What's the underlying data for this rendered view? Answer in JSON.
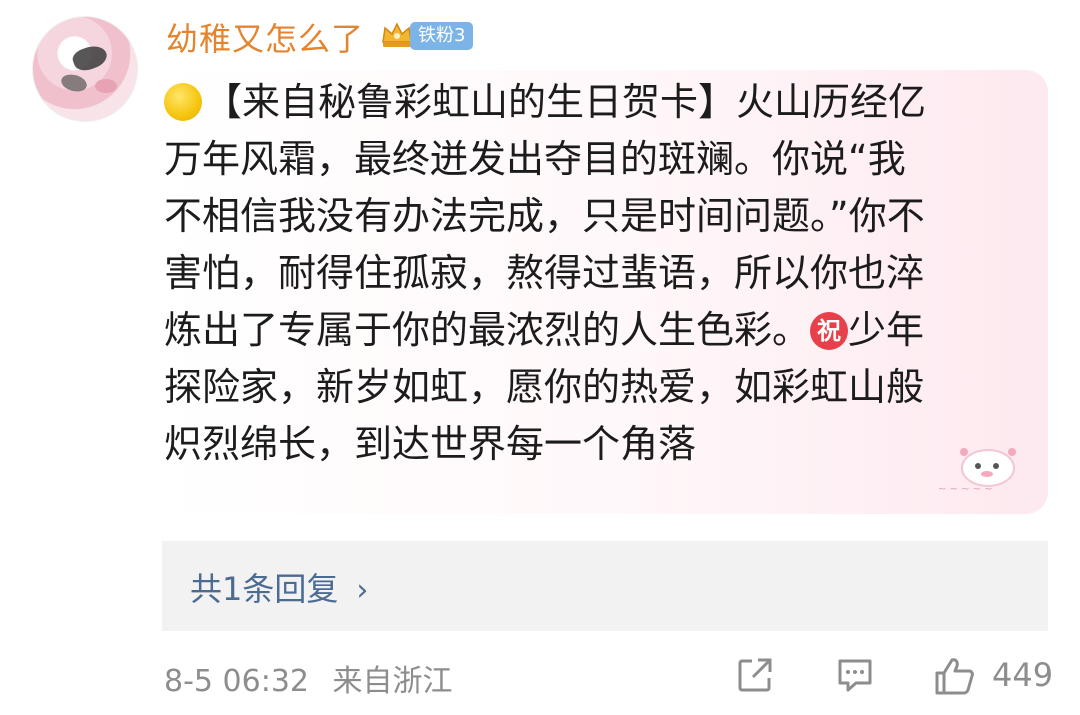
{
  "comment": {
    "username": "幼稚又怎么了",
    "fan_badge": "铁粉3",
    "icons": {
      "crown": "crown-icon",
      "sun": "yellow-circle-emoji-icon",
      "zhu": "zhu-blessing-emoji-icon"
    },
    "lines": [
      "【来自秘鲁彩虹山的生日贺卡】火山历经亿",
      "万年风霜，最终迸发出夺目的斑斓。你说“我",
      "不相信我没有办法完成，只是时间问题。”你不",
      "害怕，耐得住孤寂，熬得过蜚语，所以你也淬",
      "炼出了专属于你的最浓烈的人生色彩。",
      "少年",
      "探险家，新岁如虹，愿你的热爱，如彩虹山般",
      "炽烈绵长，到达世界每一个角落"
    ],
    "zhu_char": "祝",
    "reply_link": "共1条回复",
    "reply_chevron": "›",
    "timestamp": "8-5 06:32",
    "location": "来自浙江",
    "like_count": "449",
    "colors": {
      "username": "#e5842f",
      "link": "#4c6b93",
      "badge": "#7db4e8",
      "emoji_red": "#e8404b"
    }
  }
}
